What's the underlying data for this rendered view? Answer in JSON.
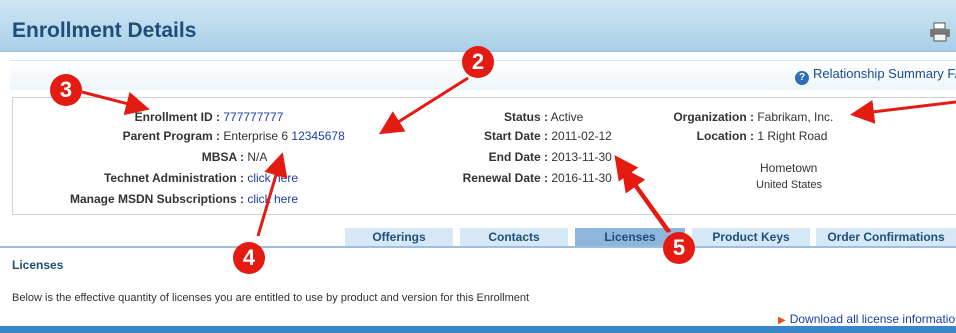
{
  "header": {
    "title": "Enrollment Details",
    "print_icon": "printer-icon"
  },
  "faq": {
    "icon": "help-icon",
    "label": "Relationship Summary FAQ"
  },
  "enrollment": {
    "enrollment_id_label": "Enrollment ID :",
    "enrollment_id_value": "777777777",
    "parent_program_label": "Parent Program :",
    "parent_program_name": "Enterprise 6",
    "parent_program_number": "12345678",
    "mbsa_label": "MBSA :",
    "mbsa_value": "N/A",
    "technet_label": "Technet Administration :",
    "technet_link": "click here",
    "msdn_label": "Manage MSDN Subscriptions :",
    "msdn_link": "click here",
    "status_label": "Status :",
    "status_value": "Active",
    "start_label": "Start Date :",
    "start_value": "2011-02-12",
    "end_label": "End Date :",
    "end_value": "2013-11-30",
    "renewal_label": "Renewal Date :",
    "renewal_value": "2016-11-30",
    "org_label": "Organization :",
    "org_value": "Fabrikam, Inc.",
    "location_label": "Location :",
    "location_line1": "1 Right Road",
    "location_line2": "Hometown",
    "location_line3": "United States"
  },
  "tabs": [
    {
      "label": "Offerings"
    },
    {
      "label": "Contacts"
    },
    {
      "label": "Licenses",
      "active": true
    },
    {
      "label": "Product Keys"
    },
    {
      "label": "Order Confirmations"
    }
  ],
  "licenses": {
    "title": "Licenses",
    "description": "Below is the effective quantity of licenses you are entitled to use by product and version for this Enrollment",
    "download_label": "Download all license information"
  },
  "callouts": [
    "3",
    "2",
    "4",
    "5"
  ],
  "colors": {
    "callout": "#e41b13",
    "header_title": "#1f4e79",
    "link": "#1a3ea8"
  }
}
